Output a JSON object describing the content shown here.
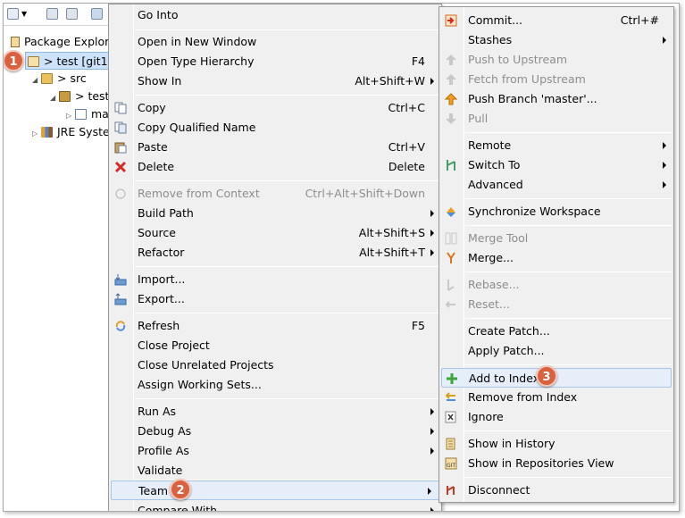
{
  "explorer": {
    "tab_label": "Package Explorer",
    "tree": [
      {
        "label": "> test  [git1",
        "icon": "project-icon",
        "selected": true
      },
      {
        "label": "> src",
        "icon": "package-folder-icon"
      },
      {
        "label": "> test",
        "icon": "package-icon"
      },
      {
        "label": "ma",
        "icon": "java-file-icon"
      },
      {
        "label": "JRE Syste",
        "icon": "library-icon"
      }
    ]
  },
  "badges": {
    "one": "1",
    "two": "2",
    "three": "3"
  },
  "context_menu": {
    "items": [
      {
        "label": "Go Into",
        "accel": ""
      },
      {
        "label": "Open in New Window",
        "accel": ""
      },
      {
        "label": "Open Type Hierarchy",
        "accel": "F4"
      },
      {
        "label": "Show In",
        "accel": "Alt+Shift+W"
      },
      {
        "label": "Copy",
        "accel": "Ctrl+C"
      },
      {
        "label": "Copy Qualified Name",
        "accel": ""
      },
      {
        "label": "Paste",
        "accel": "Ctrl+V"
      },
      {
        "label": "Delete",
        "accel": "Delete"
      },
      {
        "label": "Remove from Context",
        "accel": "Ctrl+Alt+Shift+Down"
      },
      {
        "label": "Build Path",
        "accel": ""
      },
      {
        "label": "Source",
        "accel": "Alt+Shift+S"
      },
      {
        "label": "Refactor",
        "accel": "Alt+Shift+T"
      },
      {
        "label": "Import...",
        "accel": ""
      },
      {
        "label": "Export...",
        "accel": ""
      },
      {
        "label": "Refresh",
        "accel": "F5"
      },
      {
        "label": "Close Project",
        "accel": ""
      },
      {
        "label": "Close Unrelated Projects",
        "accel": ""
      },
      {
        "label": "Assign Working Sets...",
        "accel": ""
      },
      {
        "label": "Run As",
        "accel": ""
      },
      {
        "label": "Debug As",
        "accel": ""
      },
      {
        "label": "Profile As",
        "accel": ""
      },
      {
        "label": "Validate",
        "accel": ""
      },
      {
        "label": "Team",
        "accel": ""
      },
      {
        "label": "Compare With",
        "accel": ""
      }
    ]
  },
  "team_menu": {
    "items": [
      {
        "label": "Commit...",
        "accel": "Ctrl+#"
      },
      {
        "label": "Stashes",
        "accel": ""
      },
      {
        "label": "Push to Upstream",
        "accel": ""
      },
      {
        "label": "Fetch from Upstream",
        "accel": ""
      },
      {
        "label": "Push Branch 'master'...",
        "accel": ""
      },
      {
        "label": "Pull",
        "accel": ""
      },
      {
        "label": "Remote",
        "accel": ""
      },
      {
        "label": "Switch To",
        "accel": ""
      },
      {
        "label": "Advanced",
        "accel": ""
      },
      {
        "label": "Synchronize Workspace",
        "accel": ""
      },
      {
        "label": "Merge Tool",
        "accel": ""
      },
      {
        "label": "Merge...",
        "accel": ""
      },
      {
        "label": "Rebase...",
        "accel": ""
      },
      {
        "label": "Reset...",
        "accel": ""
      },
      {
        "label": "Create Patch...",
        "accel": ""
      },
      {
        "label": "Apply Patch...",
        "accel": ""
      },
      {
        "label": "Add to Index",
        "accel": ""
      },
      {
        "label": "Remove from Index",
        "accel": ""
      },
      {
        "label": "Ignore",
        "accel": ""
      },
      {
        "label": "Show in History",
        "accel": ""
      },
      {
        "label": "Show in Repositories View",
        "accel": ""
      },
      {
        "label": "Disconnect",
        "accel": ""
      }
    ]
  },
  "colors": {
    "badge": "#d9613f",
    "highlight": "#e5eef9",
    "disabled_text": "#8d8d8d"
  }
}
